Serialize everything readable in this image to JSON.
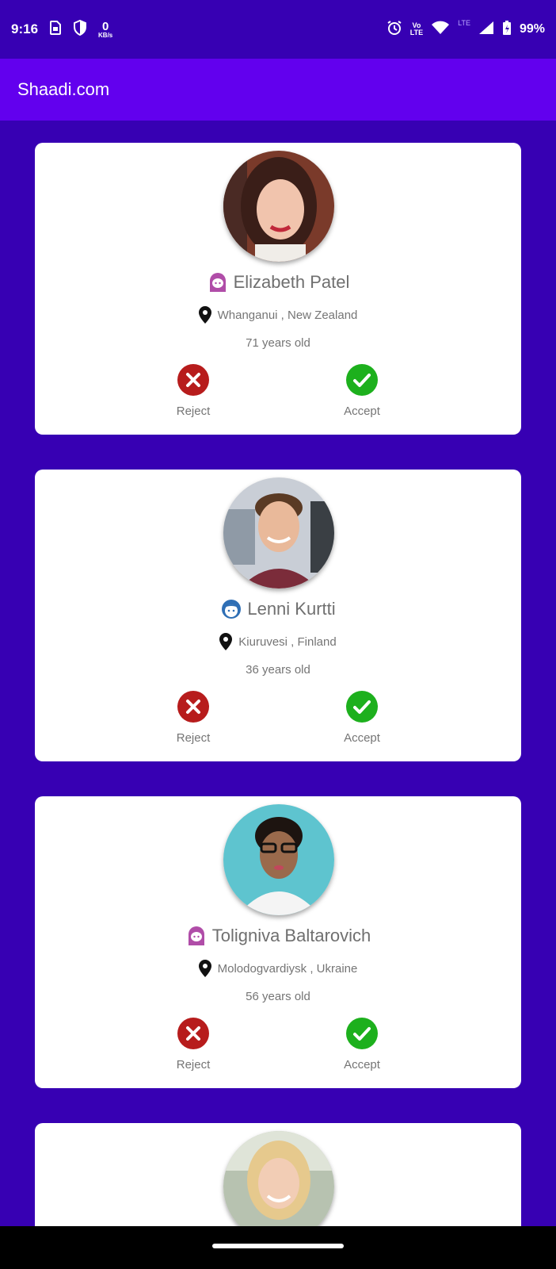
{
  "status_bar": {
    "time": "9:16",
    "net_speed_value": "0",
    "net_speed_unit": "KB/s",
    "volte_line1": "Vo",
    "volte_line2": "LTE",
    "lte_label": "LTE",
    "battery": "99%"
  },
  "app_bar": {
    "title": "Shaadi.com"
  },
  "actions": {
    "reject_label": "Reject",
    "accept_label": "Accept"
  },
  "colors": {
    "app_bar": "#6200EE",
    "background": "#3700B3",
    "reject": "#B71C1C",
    "accept": "#1DB01D",
    "female_icon": "#B04DA8",
    "male_icon": "#2F6FB5"
  },
  "profiles": [
    {
      "name": "Elizabeth Patel",
      "gender_icon": "female-icon",
      "location": "Whanganui , New Zealand",
      "age": "71 years old"
    },
    {
      "name": "Lenni Kurtti",
      "gender_icon": "male-icon",
      "location": "Kiuruvesi , Finland",
      "age": "36 years old"
    },
    {
      "name": "Toligniva Baltarovich",
      "gender_icon": "female-icon",
      "location": "Molodogvardiysk , Ukraine",
      "age": "56 years old"
    },
    {
      "name": "",
      "gender_icon": "female-icon",
      "location": "",
      "age": ""
    }
  ]
}
